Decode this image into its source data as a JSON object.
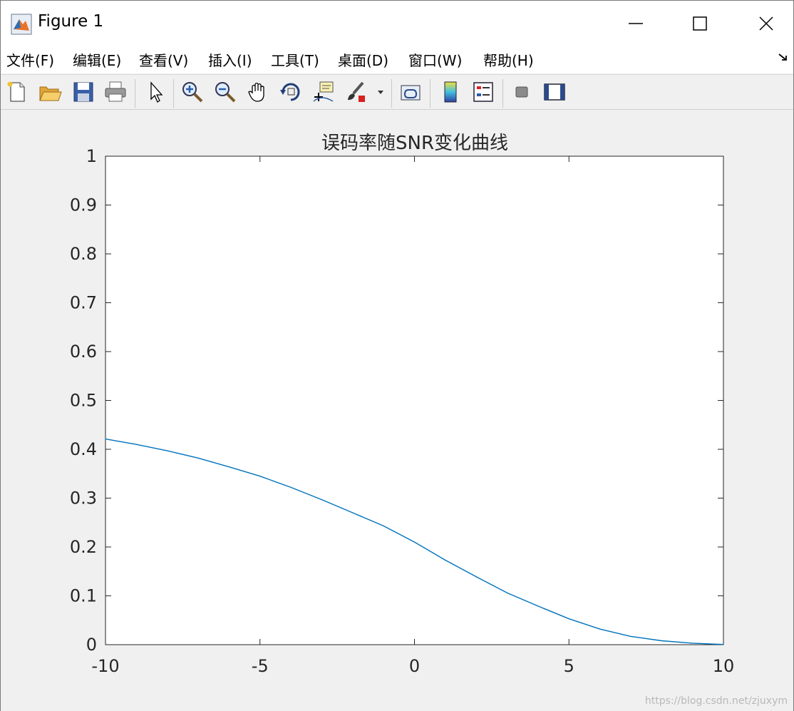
{
  "window": {
    "title": "Figure 1"
  },
  "menu": {
    "items": [
      {
        "label": "文件(F)"
      },
      {
        "label": "编辑(E)"
      },
      {
        "label": "查看(V)"
      },
      {
        "label": "插入(I)"
      },
      {
        "label": "工具(T)"
      },
      {
        "label": "桌面(D)"
      },
      {
        "label": "窗口(W)"
      },
      {
        "label": "帮助(H)"
      }
    ]
  },
  "toolbar": {
    "icons": [
      "new-figure-icon",
      "open-file-icon",
      "save-icon",
      "print-icon",
      "edit-plot-arrow-icon",
      "zoom-in-icon",
      "zoom-out-icon",
      "pan-hand-icon",
      "rotate-3d-icon",
      "data-cursor-icon",
      "brush-icon",
      "link-plot-icon",
      "colorbar-icon",
      "legend-icon",
      "hide-plot-tools-icon",
      "show-plot-tools-icon"
    ]
  },
  "chart_data": {
    "type": "line",
    "title": "误码率随SNR变化曲线",
    "xlabel": "",
    "ylabel": "",
    "xlim": [
      -10,
      10
    ],
    "ylim": [
      0,
      1
    ],
    "xticks": [
      "-10",
      "-5",
      "0",
      "5",
      "10"
    ],
    "yticks": [
      "0",
      "0.1",
      "0.2",
      "0.3",
      "0.4",
      "0.5",
      "0.6",
      "0.7",
      "0.8",
      "0.9",
      "1"
    ],
    "grid": false,
    "series": [
      {
        "color": "#0072bd",
        "x": [
          -10,
          -9,
          -8,
          -7,
          -6,
          -5,
          -4,
          -3,
          -2,
          -1,
          0,
          1,
          2,
          3,
          4,
          5,
          6,
          7,
          8,
          9,
          10
        ],
        "values": [
          0.421,
          0.41,
          0.397,
          0.382,
          0.364,
          0.345,
          0.322,
          0.297,
          0.27,
          0.243,
          0.21,
          0.173,
          0.139,
          0.106,
          0.079,
          0.053,
          0.032,
          0.017,
          0.008,
          0.003,
          0.0005
        ]
      }
    ]
  },
  "watermark": "https://blog.csdn.net/zjuxym"
}
